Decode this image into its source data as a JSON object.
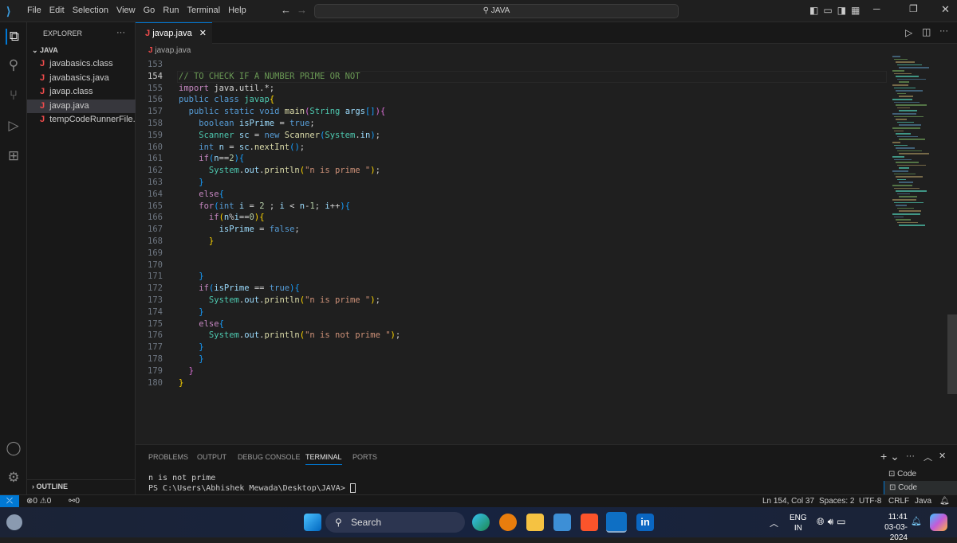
{
  "titlebar": {
    "menu": [
      "File",
      "Edit",
      "Selection",
      "View",
      "Go",
      "Run",
      "Terminal",
      "Help"
    ],
    "search": "JAVA",
    "nav_back": "←",
    "nav_forward": "→"
  },
  "sidebar": {
    "title": "EXPLORER",
    "more": "···",
    "folder": "JAVA",
    "files": [
      "javabasics.class",
      "javabasics.java",
      "javap.class",
      "javap.java",
      "tempCodeRunnerFile...."
    ],
    "selected": 3,
    "outline": "OUTLINE"
  },
  "editor": {
    "tab": "javap.java",
    "breadcrumb": "javap.java",
    "current_line": 154,
    "lines": [
      {
        "n": 153,
        "t": []
      },
      {
        "n": 154,
        "t": [
          [
            "// TO CHECK IF A NUMBER PRIME OR NOT",
            "cm"
          ]
        ]
      },
      {
        "n": 155,
        "t": [
          [
            "import",
            "ct"
          ],
          [
            " java.util.*;",
            "pl"
          ]
        ]
      },
      {
        "n": 156,
        "t": [
          [
            "public",
            "kw"
          ],
          [
            " ",
            "pl"
          ],
          [
            "class",
            "kw"
          ],
          [
            " ",
            "pl"
          ],
          [
            "javap",
            "ty"
          ],
          [
            "{",
            "b1"
          ]
        ]
      },
      {
        "n": 157,
        "t": [
          [
            "  public",
            "kw"
          ],
          [
            " ",
            "pl"
          ],
          [
            "static",
            "kw"
          ],
          [
            " ",
            "pl"
          ],
          [
            "void",
            "kw"
          ],
          [
            " ",
            "pl"
          ],
          [
            "main",
            "fn"
          ],
          [
            "(",
            "b2"
          ],
          [
            "String",
            "ty"
          ],
          [
            " ",
            "pl"
          ],
          [
            "args",
            "va"
          ],
          [
            "[]",
            "b3"
          ],
          [
            ")",
            "b2"
          ],
          [
            "{",
            "b2"
          ]
        ]
      },
      {
        "n": 158,
        "t": [
          [
            "    boolean",
            "kw"
          ],
          [
            " ",
            "pl"
          ],
          [
            "isPrime",
            "va"
          ],
          [
            " = ",
            "pl"
          ],
          [
            "true",
            "kw"
          ],
          [
            ";",
            "pl"
          ]
        ]
      },
      {
        "n": 159,
        "t": [
          [
            "    Scanner",
            "ty"
          ],
          [
            " ",
            "pl"
          ],
          [
            "sc",
            "va"
          ],
          [
            " = ",
            "pl"
          ],
          [
            "new",
            "kw"
          ],
          [
            " ",
            "pl"
          ],
          [
            "Scanner",
            "fn"
          ],
          [
            "(",
            "b3"
          ],
          [
            "System",
            "ty"
          ],
          [
            ".",
            "pl"
          ],
          [
            "in",
            "va"
          ],
          [
            ")",
            "b3"
          ],
          [
            ";",
            "pl"
          ]
        ]
      },
      {
        "n": 160,
        "t": [
          [
            "    int",
            "kw"
          ],
          [
            " ",
            "pl"
          ],
          [
            "n",
            "va"
          ],
          [
            " = ",
            "pl"
          ],
          [
            "sc",
            "va"
          ],
          [
            ".",
            "pl"
          ],
          [
            "nextInt",
            "fn"
          ],
          [
            "()",
            "b3"
          ],
          [
            ";",
            "pl"
          ]
        ]
      },
      {
        "n": 161,
        "t": [
          [
            "    if",
            "ct"
          ],
          [
            "(",
            "b3"
          ],
          [
            "n",
            "va"
          ],
          [
            "==",
            "pl"
          ],
          [
            "2",
            "nu"
          ],
          [
            ")",
            "b3"
          ],
          [
            "{",
            "b3"
          ]
        ]
      },
      {
        "n": 162,
        "t": [
          [
            "      System",
            "ty"
          ],
          [
            ".",
            "pl"
          ],
          [
            "out",
            "va"
          ],
          [
            ".",
            "pl"
          ],
          [
            "println",
            "fn"
          ],
          [
            "(",
            "b1"
          ],
          [
            "\"n is prime \"",
            "st"
          ],
          [
            ")",
            "b1"
          ],
          [
            ";",
            "pl"
          ]
        ]
      },
      {
        "n": 163,
        "t": [
          [
            "    }",
            "b3"
          ]
        ]
      },
      {
        "n": 164,
        "t": [
          [
            "    else",
            "ct"
          ],
          [
            "{",
            "b3"
          ]
        ]
      },
      {
        "n": 165,
        "t": [
          [
            "    for",
            "ct"
          ],
          [
            "(",
            "b3"
          ],
          [
            "int",
            "kw"
          ],
          [
            " ",
            "pl"
          ],
          [
            "i",
            "va"
          ],
          [
            " = ",
            "pl"
          ],
          [
            "2",
            "nu"
          ],
          [
            " ; ",
            "pl"
          ],
          [
            "i",
            "va"
          ],
          [
            " < ",
            "pl"
          ],
          [
            "n",
            "va"
          ],
          [
            "-",
            "pl"
          ],
          [
            "1",
            "nu"
          ],
          [
            "; ",
            "pl"
          ],
          [
            "i",
            "va"
          ],
          [
            "++",
            "pl"
          ],
          [
            ")",
            "b3"
          ],
          [
            "{",
            "b3"
          ]
        ]
      },
      {
        "n": 166,
        "t": [
          [
            "      if",
            "ct"
          ],
          [
            "(",
            "b1"
          ],
          [
            "n",
            "va"
          ],
          [
            "%",
            "pl"
          ],
          [
            "i",
            "va"
          ],
          [
            "==",
            "pl"
          ],
          [
            "0",
            "nu"
          ],
          [
            ")",
            "b1"
          ],
          [
            "{",
            "b1"
          ]
        ]
      },
      {
        "n": 167,
        "t": [
          [
            "        isPrime",
            "va"
          ],
          [
            " = ",
            "pl"
          ],
          [
            "false",
            "kw"
          ],
          [
            ";",
            "pl"
          ]
        ]
      },
      {
        "n": 168,
        "t": [
          [
            "      }",
            "b1"
          ]
        ]
      },
      {
        "n": 169,
        "t": []
      },
      {
        "n": 170,
        "t": []
      },
      {
        "n": 171,
        "t": [
          [
            "    }",
            "b3"
          ]
        ]
      },
      {
        "n": 172,
        "t": [
          [
            "    if",
            "ct"
          ],
          [
            "(",
            "b3"
          ],
          [
            "isPrime",
            "va"
          ],
          [
            " == ",
            "pl"
          ],
          [
            "true",
            "kw"
          ],
          [
            ")",
            "b3"
          ],
          [
            "{",
            "b3"
          ]
        ]
      },
      {
        "n": 173,
        "t": [
          [
            "      System",
            "ty"
          ],
          [
            ".",
            "pl"
          ],
          [
            "out",
            "va"
          ],
          [
            ".",
            "pl"
          ],
          [
            "println",
            "fn"
          ],
          [
            "(",
            "b1"
          ],
          [
            "\"n is prime \"",
            "st"
          ],
          [
            ")",
            "b1"
          ],
          [
            ";",
            "pl"
          ]
        ]
      },
      {
        "n": 174,
        "t": [
          [
            "    }",
            "b3"
          ]
        ]
      },
      {
        "n": 175,
        "t": [
          [
            "    else",
            "ct"
          ],
          [
            "{",
            "b3"
          ]
        ]
      },
      {
        "n": 176,
        "t": [
          [
            "      System",
            "ty"
          ],
          [
            ".",
            "pl"
          ],
          [
            "out",
            "va"
          ],
          [
            ".",
            "pl"
          ],
          [
            "println",
            "fn"
          ],
          [
            "(",
            "b1"
          ],
          [
            "\"n is not prime \"",
            "st"
          ],
          [
            ")",
            "b1"
          ],
          [
            ";",
            "pl"
          ]
        ]
      },
      {
        "n": 177,
        "t": [
          [
            "    }",
            "b3"
          ]
        ]
      },
      {
        "n": 178,
        "t": [
          [
            "    }",
            "b3"
          ]
        ]
      },
      {
        "n": 179,
        "t": [
          [
            "  }",
            "b2"
          ]
        ]
      },
      {
        "n": 180,
        "t": [
          [
            "}",
            "b1"
          ]
        ]
      }
    ]
  },
  "panel": {
    "tabs": [
      "PROBLEMS",
      "OUTPUT",
      "DEBUG CONSOLE",
      "TERMINAL",
      "PORTS"
    ],
    "active": 3,
    "terminal": [
      "n is not prime",
      "PS C:\\Users\\Abhishek Mewada\\Desktop\\JAVA> "
    ],
    "terminals": [
      "Code",
      "Code"
    ],
    "add": "+",
    "more": "···"
  },
  "status": {
    "errors": "0",
    "warnings": "0",
    "ports": "0",
    "position": "Ln 154, Col 37",
    "spaces": "Spaces: 2",
    "encoding": "UTF-8",
    "eol": "CRLF",
    "language": "Java"
  },
  "taskbar": {
    "search": "Search",
    "lang1": "ENG",
    "lang2": "IN",
    "time": "11:41",
    "date": "03-03-2024"
  },
  "colors": {
    "accent": "#0078d4",
    "java_icon": "#f14c4c"
  }
}
